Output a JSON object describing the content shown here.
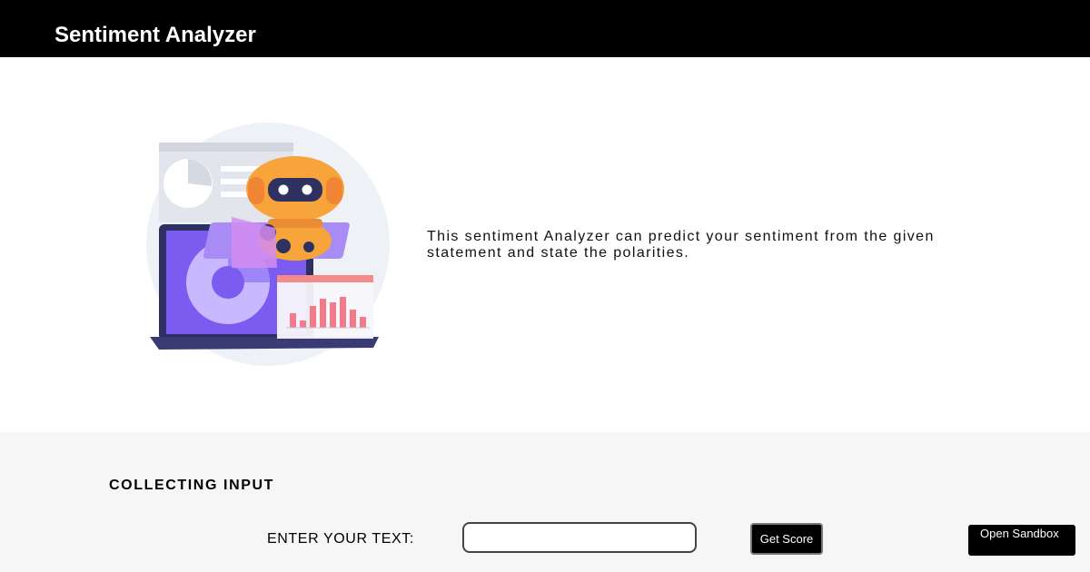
{
  "header": {
    "title": "Sentiment Analyzer"
  },
  "hero": {
    "illustration_icon": "robot-analytics-illustration",
    "description": "This sentiment Analyzer can predict your sentiment from the given statement and state the polarities."
  },
  "input_section": {
    "title": "COLLECTING INPUT",
    "label": "ENTER YOUR TEXT:",
    "input_value": "",
    "input_placeholder": "",
    "get_score_label": "Get Score",
    "sandbox_label": "Open Sandbox"
  },
  "colors": {
    "header_bg": "#000000",
    "section_bg": "#f6f6f6",
    "illustration_purple": "#7b5cf0",
    "illustration_orange": "#f7a43a",
    "illustration_pink": "#f27a8a"
  }
}
